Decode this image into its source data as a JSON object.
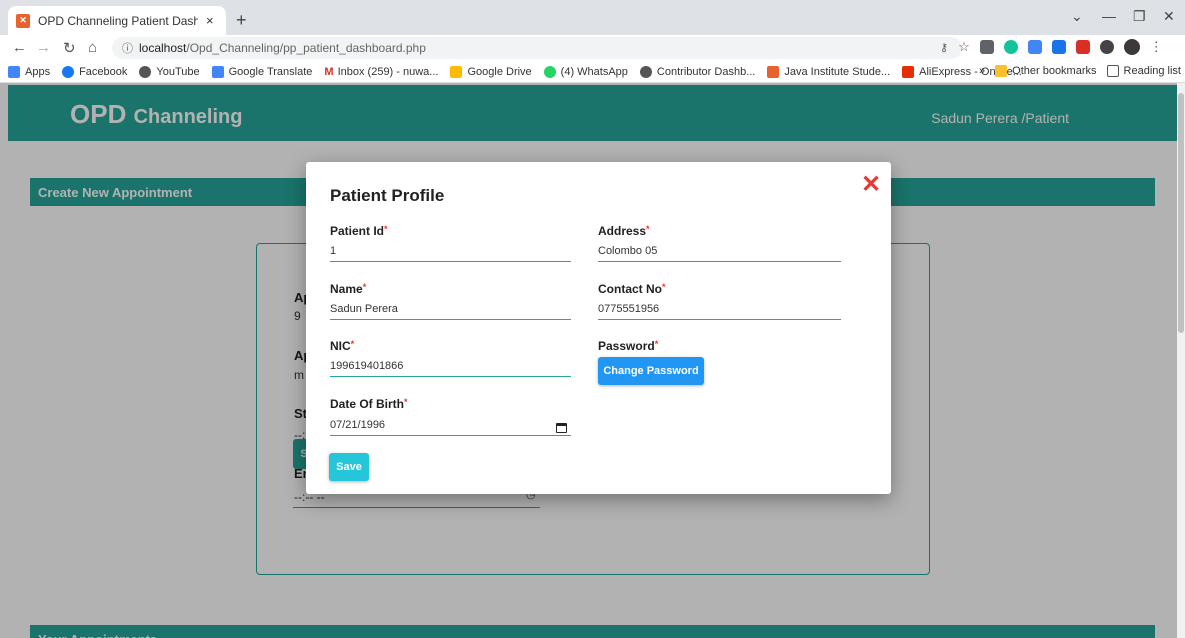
{
  "browser": {
    "tab_title": "OPD Channeling Patient Dashbo",
    "tab_close": "×",
    "new_tab": "+",
    "url_host": "localhost",
    "url_path": "/Opd_Channeling/pp_patient_dashboard.php",
    "bookmarks": [
      {
        "label": "Apps",
        "color": "#4285f4"
      },
      {
        "label": "Facebook",
        "color": "#1877f2"
      },
      {
        "label": "YouTube",
        "color": "#555555"
      },
      {
        "label": "Google Translate",
        "color": "#4285f4"
      },
      {
        "label": "Inbox (259) - nuwa...",
        "color": "#d93025"
      },
      {
        "label": "Google Drive",
        "color": "#fbbc04"
      },
      {
        "label": "(4) WhatsApp",
        "color": "#25d366"
      },
      {
        "label": "Contributor Dashb...",
        "color": "#555555"
      },
      {
        "label": "Java Institute Stude...",
        "color": "#e8622c"
      },
      {
        "label": "AliExpress - Online...",
        "color": "#e62e04"
      }
    ],
    "bookmarks_overflow": "»",
    "other_bookmarks": "Other bookmarks",
    "reading_list": "Reading list"
  },
  "navbar": {
    "brand_main": "OPD",
    "brand_sub": "Channeling",
    "user": "Sadun Perera /Patient"
  },
  "background": {
    "create_title": "Create New Appointment",
    "appointments_title": "Your Appointments",
    "labels": [
      "Ap",
      "Ap",
      "St",
      "En"
    ],
    "values": [
      "9",
      "m",
      "--:",
      "--:-- --"
    ],
    "submit": "Submit"
  },
  "modal": {
    "title": "Patient Profile",
    "close": "✕",
    "fields": {
      "patient_id": {
        "label": "Patient Id",
        "value": "1"
      },
      "name": {
        "label": "Name",
        "value": "Sadun Perera"
      },
      "nic": {
        "label": "NIC",
        "value": "199619401866"
      },
      "dob": {
        "label": "Date Of Birth",
        "value": "07/21/1996"
      },
      "address": {
        "label": "Address",
        "value": "Colombo 05"
      },
      "contact": {
        "label": "Contact No",
        "value": "0775551956"
      },
      "password": {
        "label": "Password"
      }
    },
    "required_mark": "*",
    "change_password": "Change Password",
    "save": "Save"
  },
  "colors": {
    "teal": "#26a69a",
    "close_red": "#e53935",
    "change_blue": "#2196f3",
    "save_cyan": "#26c6da"
  }
}
